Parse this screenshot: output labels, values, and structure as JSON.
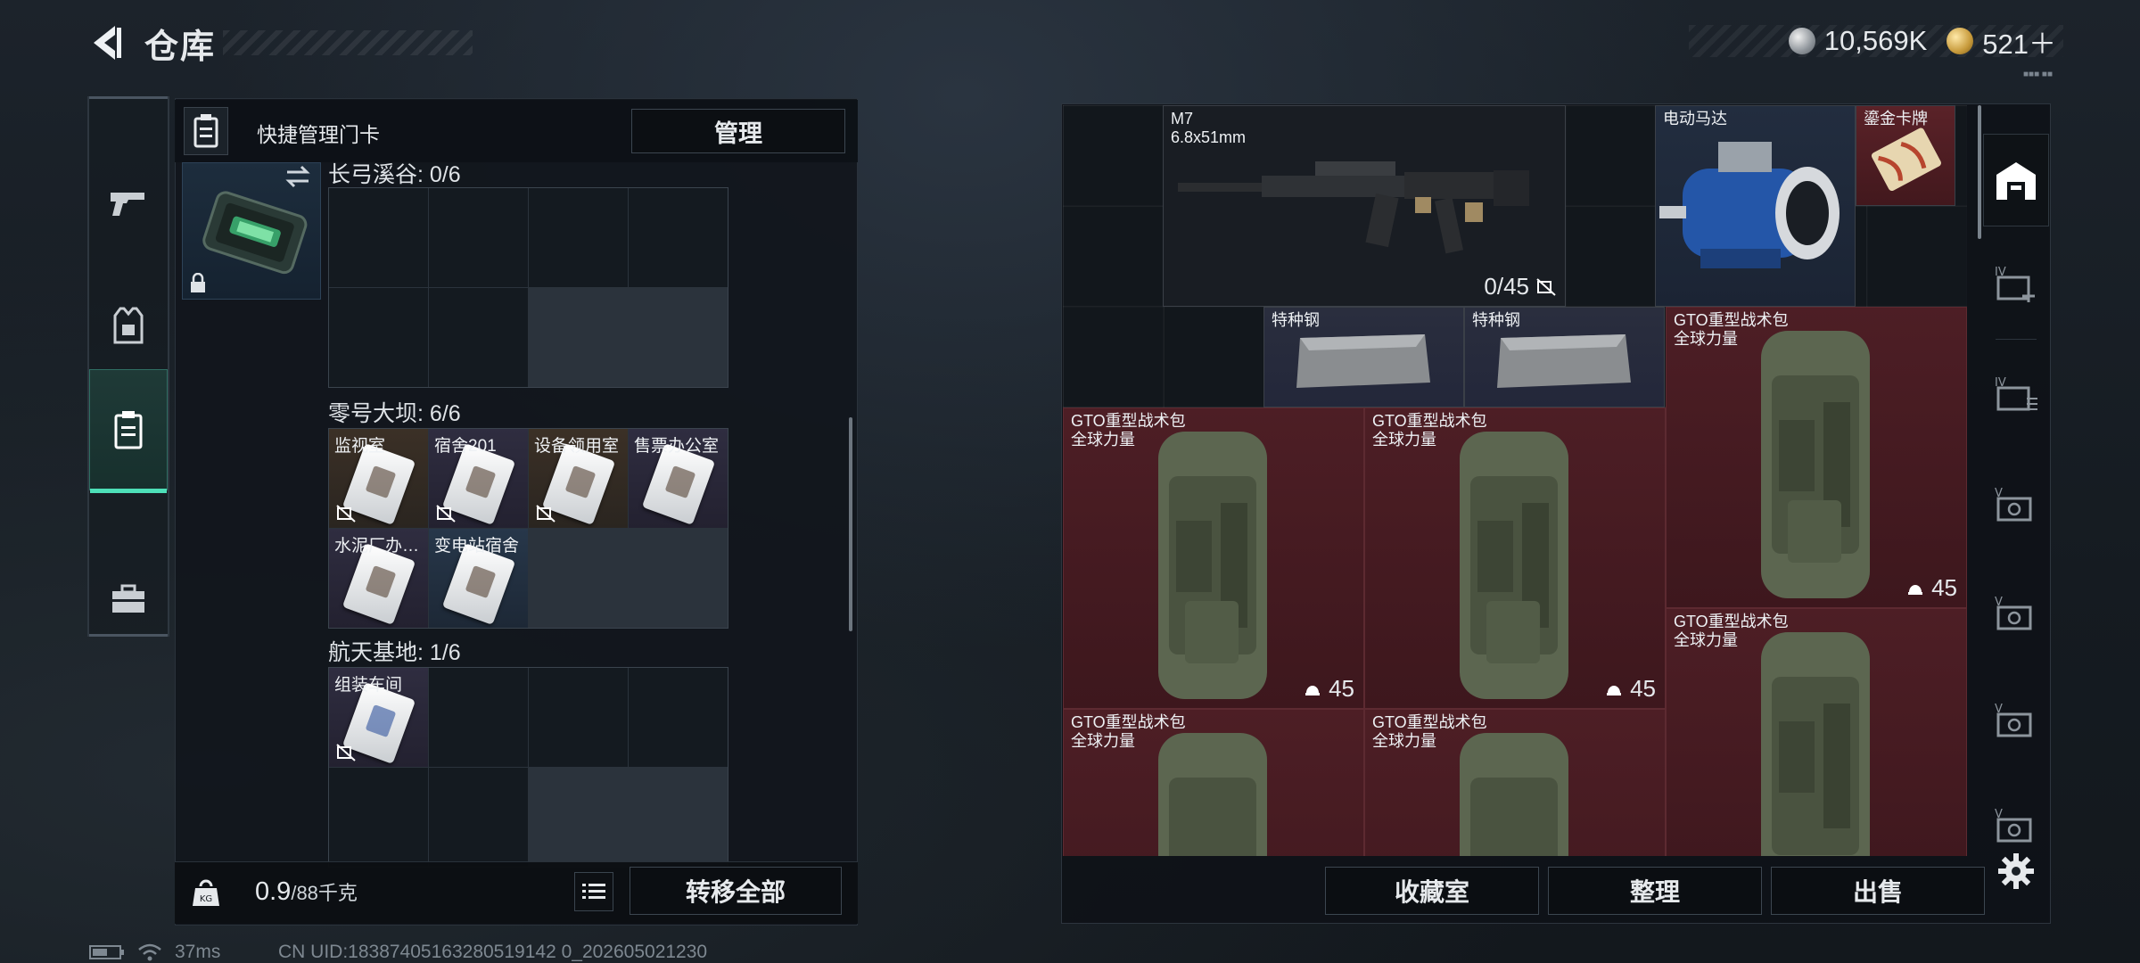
{
  "header": {
    "title": "仓库",
    "back_icon": "chevron-left-icon"
  },
  "currency": {
    "silver_value": "10,569K",
    "gold_value": "521＋",
    "sub_text": "■■■ ■■"
  },
  "left_tabs": [
    {
      "name": "weapons",
      "icon": "pistol-icon",
      "active": false
    },
    {
      "name": "equipment",
      "icon": "vest-icon",
      "active": false
    },
    {
      "name": "keycards",
      "icon": "keycard-holder-icon",
      "active": true
    },
    {
      "name": "supplies",
      "icon": "toolbox-icon",
      "active": false
    }
  ],
  "keycard_panel": {
    "header_label": "快捷管理门卡",
    "manage_label": "管理",
    "groups": [
      {
        "label": "长弓溪谷: 0/6",
        "cards": []
      },
      {
        "label": "零号大坝: 6/6",
        "cards": [
          {
            "name": "监视室",
            "color": "brown"
          },
          {
            "name": "宿舍201",
            "color": "purple"
          },
          {
            "name": "设备领用室",
            "color": "brown"
          },
          {
            "name": "售票办公室",
            "color": "purple"
          },
          {
            "name": "水泥厂办…",
            "color": "purple"
          },
          {
            "name": "变电站宿舍",
            "color": "blue"
          }
        ]
      },
      {
        "label": "航天基地: 1/6",
        "cards": [
          {
            "name": "组装车间",
            "color": "purple"
          }
        ]
      }
    ],
    "weight_value": "0.9",
    "weight_unit": "/88千克",
    "transfer_label": "转移全部"
  },
  "stash": {
    "items": [
      {
        "name": "M7",
        "sub": "6.8x51mm",
        "count": "0/45",
        "bg": "dark"
      },
      {
        "name": "电动马达",
        "bg": "navy"
      },
      {
        "name": "鎏金卡牌",
        "bg": "redish"
      },
      {
        "name": "特种钢",
        "bg": "slate"
      },
      {
        "name": "特种钢",
        "bg": "slate"
      },
      {
        "name": "GTO重型战术包",
        "sub": "全球力量",
        "count": "45",
        "bg": "red"
      },
      {
        "name": "GTO重型战术包",
        "sub": "全球力量",
        "count": "45",
        "bg": "red"
      },
      {
        "name": "GTO重型战术包",
        "sub": "全球力量",
        "count": "45",
        "bg": "red"
      },
      {
        "name": "GTO重型战术包",
        "sub": "全球力量",
        "count": "",
        "bg": "red"
      },
      {
        "name": "GTO重型战术包",
        "sub": "全球力量",
        "count": "",
        "bg": "red"
      },
      {
        "name": "GTO重型战术包",
        "sub": "全球力量",
        "count": "",
        "bg": "red"
      }
    ],
    "buttons": {
      "collection": "收藏室",
      "sort": "整理",
      "sell": "出售"
    }
  },
  "right_tabs": [
    {
      "name": "stash-main",
      "icon": "warehouse-icon",
      "active": true
    },
    {
      "name": "stash-iv-add",
      "icon": "stash-iv-add-icon",
      "label": "IV"
    },
    {
      "name": "stash-iv",
      "icon": "stash-iv-icon",
      "label": "IV"
    },
    {
      "name": "stash-v-1",
      "icon": "stash-v-icon",
      "label": "V"
    },
    {
      "name": "stash-v-2",
      "icon": "stash-v-icon",
      "label": "V"
    },
    {
      "name": "stash-v-3",
      "icon": "stash-v-icon",
      "label": "V"
    },
    {
      "name": "stash-v-4",
      "icon": "stash-v-icon",
      "label": "V"
    }
  ],
  "status": {
    "ping": "37ms",
    "uid": "CN UID:18387405163280519142 0_202605021230"
  },
  "colors": {
    "accent": "#4de0b8",
    "item_red": "#4d1e25",
    "item_slate": "#2a2e3e"
  }
}
